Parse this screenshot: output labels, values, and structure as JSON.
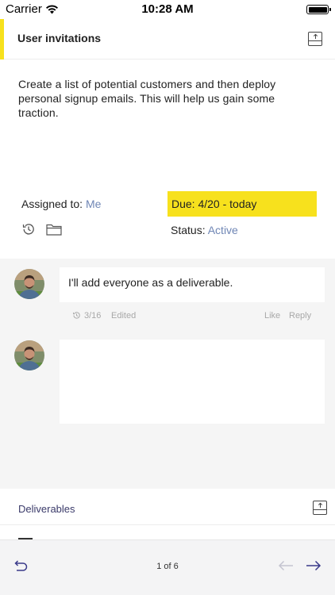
{
  "status_bar": {
    "carrier": "Carrier",
    "time": "10:28 AM"
  },
  "task": {
    "title": "User invitations",
    "description": "Create a list of potential customers and then deploy personal signup emails.  This will help us gain some traction.",
    "assigned_label": "Assigned to:",
    "assigned_value": "Me",
    "due_text": "Due: 4/20 - today",
    "status_label": "Status:",
    "status_value": "Active"
  },
  "comments": [
    {
      "text": "I'll add everyone as a deliverable.",
      "date": "3/16",
      "edited": "Edited",
      "like": "Like",
      "reply": "Reply"
    }
  ],
  "deliverables": {
    "label": "Deliverables"
  },
  "toolbar": {
    "pager": "1 of 6"
  },
  "colors": {
    "accent": "#f7e11d",
    "link": "#6f86b5",
    "comment_bg": "#f5f5f5"
  },
  "icons": [
    "wifi-icon",
    "battery-icon",
    "tray-upload-icon",
    "history-icon",
    "folder-icon",
    "undo-icon",
    "arrow-left-icon",
    "arrow-right-icon"
  ]
}
